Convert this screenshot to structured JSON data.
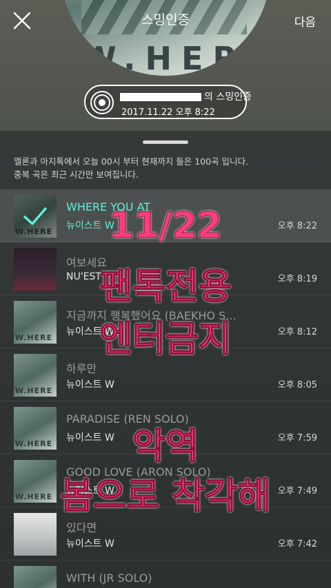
{
  "header": {
    "circle_title": "스밍인증",
    "next_label": "다음",
    "album_letters": "W.HERE"
  },
  "badge": {
    "name_suffix": "의 스밍인증",
    "date": "2017.11.22 오후 8:22"
  },
  "notice": {
    "line1": "멜론과 아지톡에서 오늘 00시 부터 현재까지 들은 100곡 입니다.",
    "line2": "중복 곡은 최근 시간만 보여집니다."
  },
  "tracks": [
    {
      "title": "WHERE YOU AT",
      "artist": "뉴이스트 W",
      "time": "오후 8:22",
      "selected": true
    },
    {
      "title": "여보세요",
      "artist": "NU'EST",
      "time": "오후 8:19"
    },
    {
      "title": "지금까지 행복했어요 (BAEKHO S...",
      "artist": "뉴이스트 W",
      "time": "오후 8:12"
    },
    {
      "title": "하루만",
      "artist": "뉴이스트 W",
      "time": "오후 8:05"
    },
    {
      "title": "PARADISE (REN SOLO)",
      "artist": "뉴이스트 W",
      "time": "오후 7:59"
    },
    {
      "title": "GOOD LOVE (ARON SOLO)",
      "artist": "뉴이스트 W",
      "time": "오후 7:49"
    },
    {
      "title": "있다면",
      "artist": "뉴이스트 W",
      "time": "오후 7:42"
    },
    {
      "title": "WITH (JR SOLO)",
      "artist": "",
      "time": ""
    }
  ],
  "overlay": {
    "line1": "11/22",
    "line2": "팬톡전용",
    "line3": "엔터금지",
    "line4": "악역",
    "line5": "봄으로 착각해"
  },
  "colors": {
    "selected_text": "#5ff0d8",
    "overlay_text": "#ff3d7f"
  }
}
